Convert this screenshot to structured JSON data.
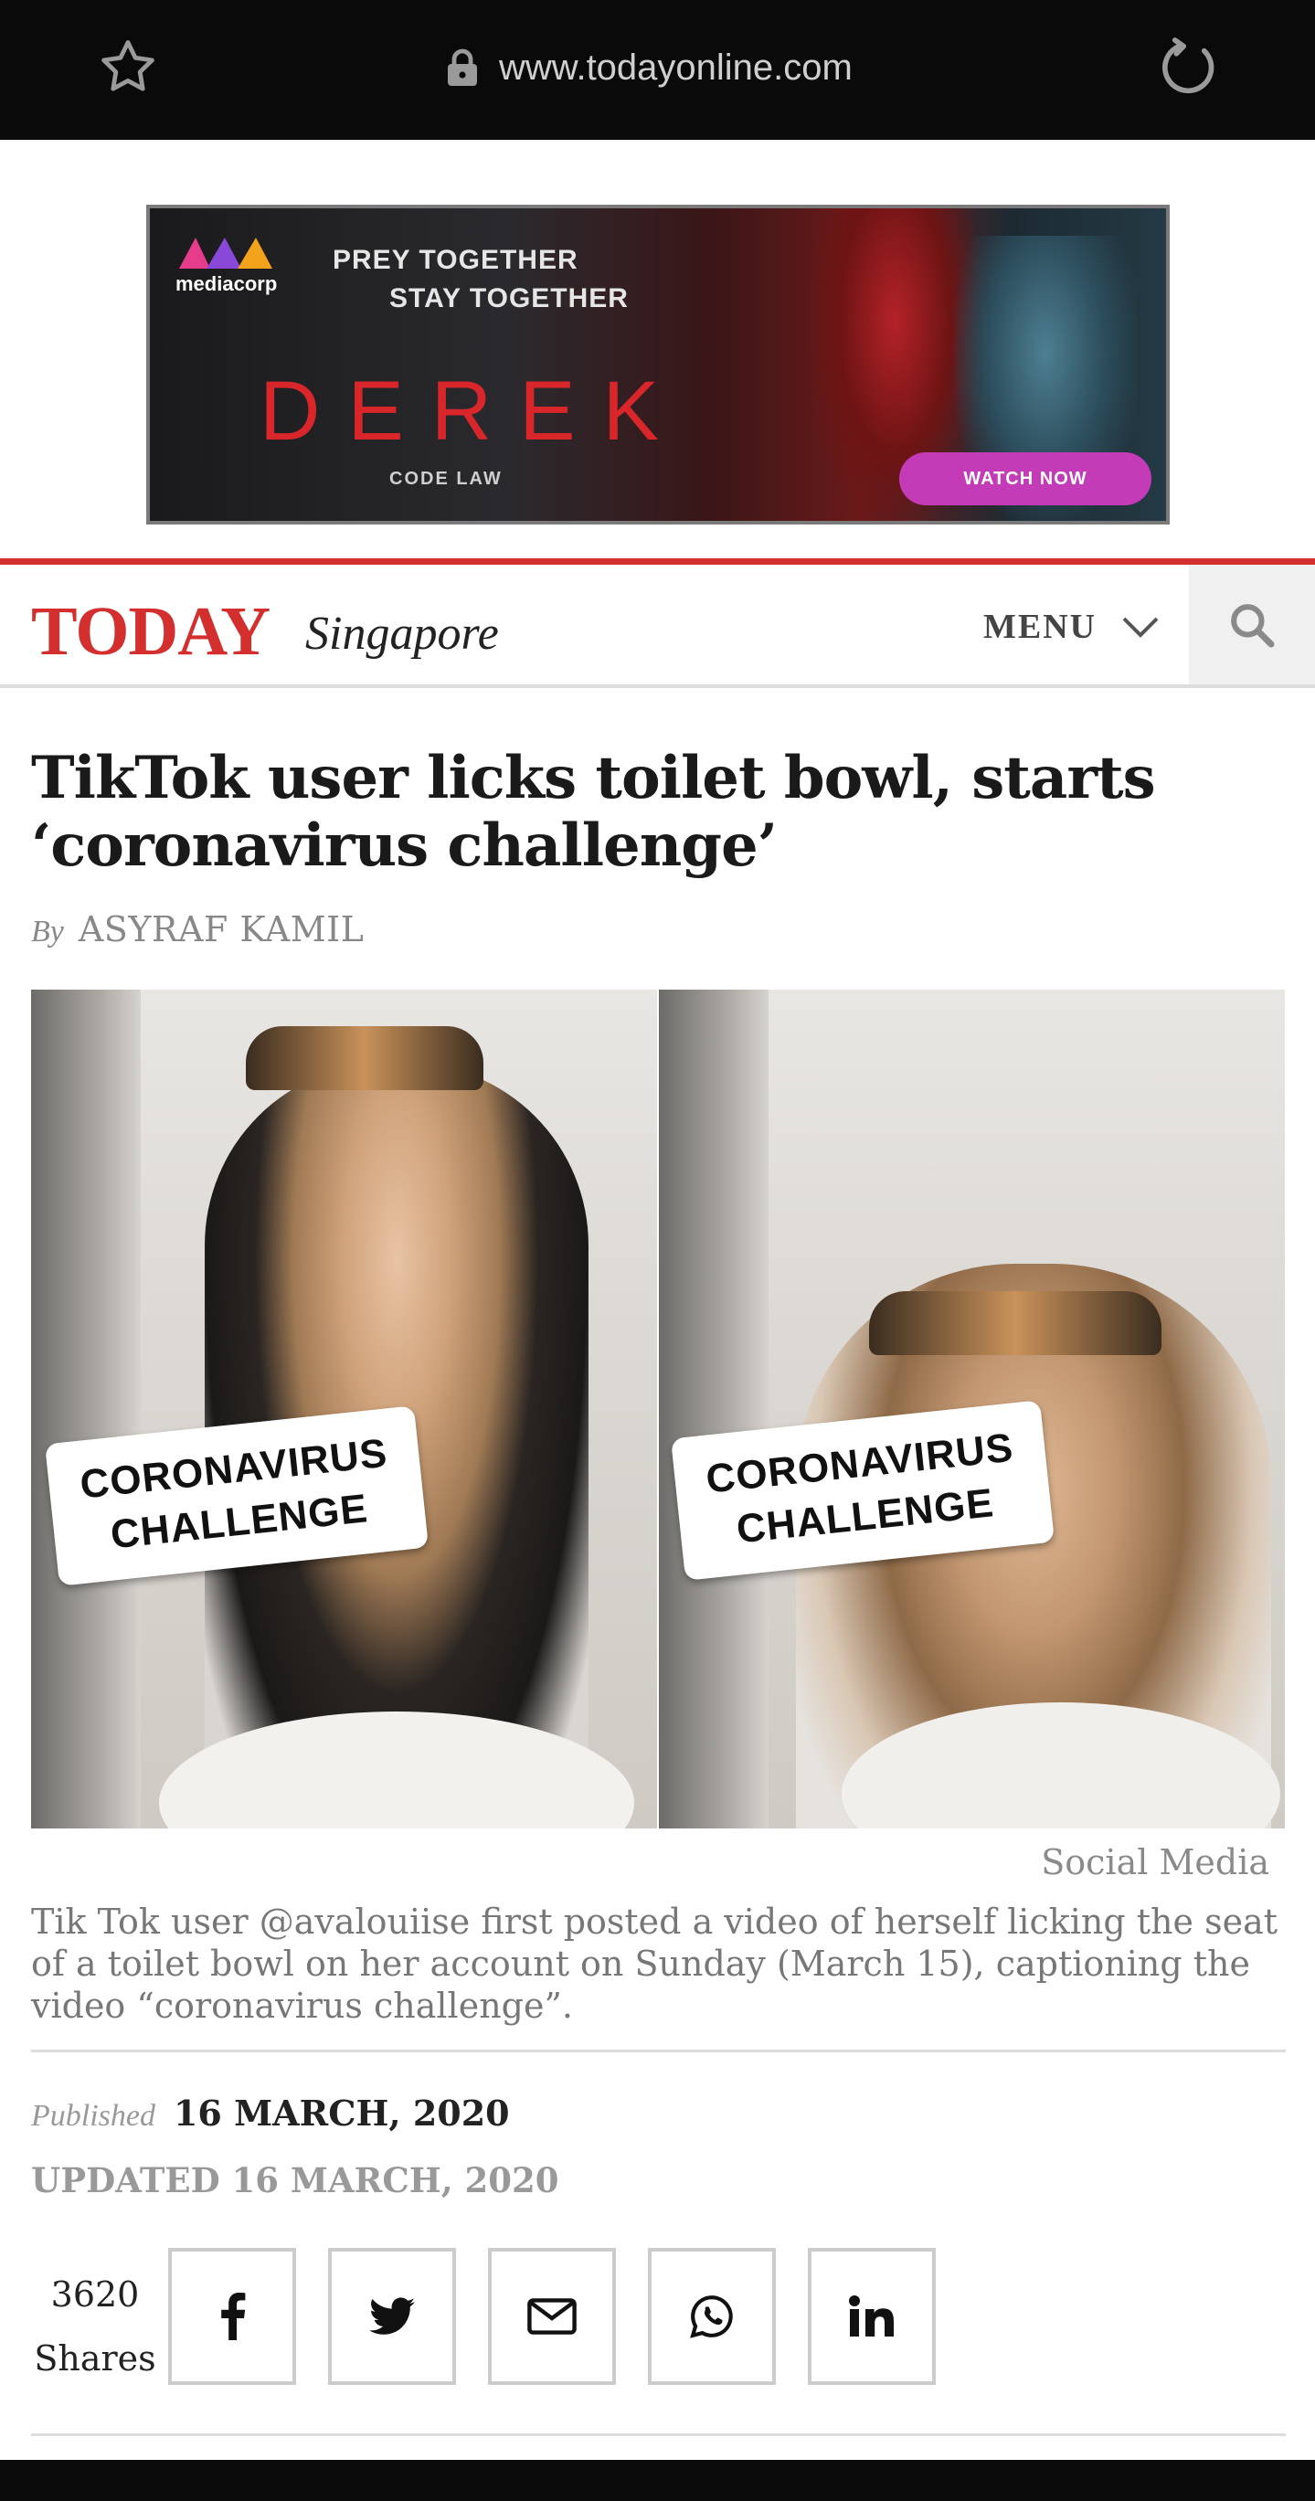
{
  "browser": {
    "url": "www.todayonline.com",
    "icons": [
      "star-icon",
      "lock-icon",
      "reload-icon"
    ]
  },
  "ad": {
    "brand": "mediacorp",
    "tagline_1": "PREY TOGETHER",
    "tagline_2": "STAY TOGETHER",
    "title": "DEREK",
    "subtitle": "CODE LAW",
    "cta": "WATCH NOW",
    "colors": {
      "title": "#d8262b",
      "cta": "#c43bb8"
    }
  },
  "header": {
    "logo": "TODAY",
    "edition": "Singapore",
    "menu_label": "MENU",
    "icons": [
      "chevron-down-icon",
      "search-icon"
    ],
    "accent_color": "#d32f2f"
  },
  "article": {
    "headline": "TikTok user licks toilet bowl, starts ‘coronavirus challenge’",
    "byline_prefix": "By",
    "author": "ASYRAF KAMIL",
    "image": {
      "sticker_left_line1": "CORONAVIRUS",
      "sticker_left_line2": "CHALLENGE",
      "sticker_right_line1": "CORONAVIRUS",
      "sticker_right_line2": "CHALLENGE"
    },
    "image_credit": "Social Media",
    "caption": "Tik Tok user @avalouiise first posted a video of herself licking the seat of a toilet bowl on her account on Sunday (March 15), captioning the video “coronavirus challenge”.",
    "published_label": "Published",
    "published_date": "16 MARCH, 2020",
    "updated": "UPDATED 16 MARCH, 2020",
    "shares_count": "3620",
    "shares_label": "Shares",
    "share_buttons": [
      "facebook-icon",
      "twitter-icon",
      "email-icon",
      "whatsapp-icon",
      "linkedin-icon"
    ]
  }
}
